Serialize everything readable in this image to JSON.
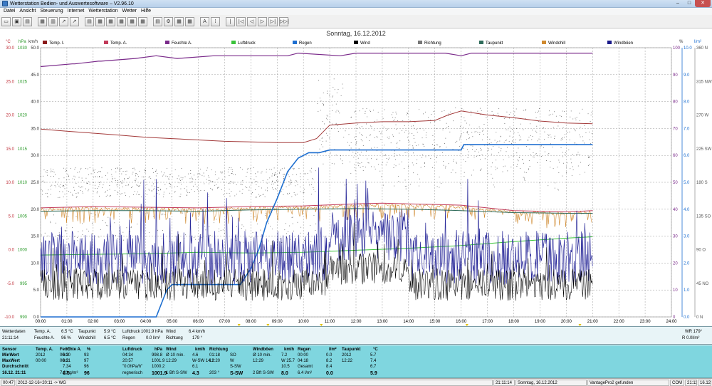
{
  "window": {
    "title": "Wetterstation Bedien- und Auswertesoftware – V2.96.10"
  },
  "menu": [
    "Datei",
    "Ansicht",
    "Steuerung",
    "Internet",
    "Wetterstation",
    "Wetter",
    "Hilfe"
  ],
  "toolbar": {
    "icons": [
      "open-icon",
      "save-icon",
      "print-icon",
      "table-icon",
      "chart-icon",
      "chart2-icon",
      "chart3-icon",
      "list-icon",
      "grid-icon",
      "grid2-icon",
      "grid3-icon",
      "grid4-icon",
      "grid5-icon",
      "export-icon",
      "settings-icon",
      "calc-icon",
      "calendar-icon",
      "font-a-icon",
      "text-icon",
      "nav-first-icon",
      "nav-prev-icon",
      "nav-back-icon",
      "nav-forward-icon",
      "nav-next-icon",
      "nav-last-icon"
    ],
    "glyphs": [
      "▭",
      "▣",
      "▤",
      "▦",
      "▥",
      "↗",
      "↗",
      "▤",
      "▦",
      "▦",
      "▦",
      "▦",
      "▦",
      "▤",
      "⚙",
      "▦",
      "▦",
      "A",
      "⁞",
      "|",
      "|◁",
      "◁",
      "▷",
      "▷|",
      "▷▷|"
    ]
  },
  "chart_data": {
    "type": "line",
    "title": "Sonntag, 16.12.2012",
    "x_ticks": [
      "00:00",
      "01:00",
      "02:00",
      "03:00",
      "04:00",
      "05:00",
      "06:00",
      "07:00",
      "08:00",
      "09:00",
      "10:00",
      "11:00",
      "12:00",
      "13:00",
      "14:00",
      "15:00",
      "16:00",
      "17:00",
      "18:00",
      "19:00",
      "20:00",
      "21:00",
      "22:00",
      "23:00",
      "24:00"
    ],
    "x_range_hours": [
      0,
      24
    ],
    "x_markers": [
      {
        "label": "07:33",
        "hour": 7.55
      },
      {
        "label": "08:39",
        "hour": 8.65
      },
      {
        "label": "10:41",
        "hour": 10.68
      },
      {
        "label": "16:13",
        "hour": 16.22
      },
      {
        "label": "20:31",
        "hour": 20.52
      }
    ],
    "axes": {
      "temp_c": {
        "unit": "°C",
        "range": [
          -10,
          30
        ],
        "ticks": [
          "30.0",
          "25.0",
          "20.0",
          "15.0",
          "10.0",
          "5.0",
          "0.0",
          "-5.0",
          "-10.0"
        ]
      },
      "pressure_hpa": {
        "unit": "hPa",
        "range": [
          990,
          1030
        ],
        "ticks": [
          "1030",
          "1025",
          "1020",
          "1015",
          "1010",
          "1005",
          "1000",
          "995",
          "990"
        ]
      },
      "wind_kmh": {
        "unit": "km/h",
        "range": [
          0,
          50
        ],
        "ticks": [
          "50.0",
          "45.0",
          "40.0",
          "35.0",
          "30.0",
          "25.0",
          "20.0",
          "15.0",
          "10.0",
          "5.0",
          "0.0"
        ]
      },
      "humidity_pct": {
        "unit": "%",
        "range": [
          0,
          100
        ],
        "ticks": [
          "100",
          "90",
          "80",
          "70",
          "60",
          "50",
          "40",
          "30",
          "20",
          "10",
          "0"
        ]
      },
      "rain_lm2": {
        "unit": "l/m²",
        "range": [
          0,
          10
        ],
        "ticks": [
          "10.0",
          "9.0",
          "8.0",
          "7.0",
          "6.0",
          "5.0",
          "4.0",
          "3.0",
          "2.0",
          "1.0",
          "0.0"
        ]
      },
      "direction": {
        "ticks": [
          "360 N",
          "315 NW",
          "270 W",
          "225 SW",
          "180 S",
          "135 SO",
          "90 O",
          "45 NO",
          "0 N"
        ]
      }
    },
    "legend": [
      {
        "name": "Temp. I.",
        "color": "#8b1a1a"
      },
      {
        "name": "Temp. A.",
        "color": "#c23b5a"
      },
      {
        "name": "Feuchte A.",
        "color": "#7a2a8a"
      },
      {
        "name": "Luftdruck",
        "color": "#3ac23a"
      },
      {
        "name": "Regen",
        "color": "#1e6fd0"
      },
      {
        "name": "Wind",
        "color": "#000000"
      },
      {
        "name": "Richtung",
        "color": "#777777"
      },
      {
        "name": "Taupunkt",
        "color": "#2f6b5a"
      },
      {
        "name": "Windchill",
        "color": "#d08a30"
      },
      {
        "name": "Windböen",
        "color": "#1a1a8a"
      }
    ],
    "series": {
      "temp_inside": {
        "axis": "temp_c",
        "hours": [
          0,
          1,
          2,
          3,
          4,
          5,
          6,
          7,
          8,
          9,
          10,
          10.5,
          11,
          12,
          13,
          14,
          15,
          15.5,
          16,
          17,
          18,
          19,
          20,
          21
        ],
        "values": [
          17.9,
          17.6,
          17.3,
          17.0,
          16.7,
          16.5,
          16.3,
          16.1,
          16.0,
          15.9,
          15.9,
          16.5,
          18.5,
          18.8,
          19.0,
          19.0,
          19.2,
          20.0,
          20.6,
          20.0,
          19.6,
          19.1,
          18.8,
          18.7
        ]
      },
      "humidity": {
        "axis": "humidity_pct",
        "hours": [
          0,
          1.2,
          1.3,
          2.2,
          2.3,
          3.6,
          4.4,
          5.2,
          6.6,
          7.0,
          7.4,
          8.6,
          9.4,
          9.8,
          11.4,
          12.0,
          13.0,
          15.4,
          16.0,
          16.4,
          18.2,
          21.0
        ],
        "values": [
          93,
          94,
          94,
          95,
          95,
          96,
          97,
          96,
          97,
          97,
          97,
          97,
          97,
          98,
          97,
          98,
          98,
          98,
          97,
          98,
          98,
          98
        ]
      },
      "temp_outside": {
        "axis": "temp_c",
        "hours": [
          0,
          2,
          4,
          6,
          8,
          10,
          12,
          13,
          14,
          16,
          18,
          20,
          21
        ],
        "values": [
          6.2,
          6.4,
          6.3,
          6.2,
          6.4,
          6.5,
          6.8,
          6.9,
          6.8,
          6.6,
          5.8,
          5.6,
          5.8
        ]
      },
      "dewpoint": {
        "axis": "temp_c",
        "hours": [
          0,
          2,
          4,
          6,
          8,
          10,
          12,
          14,
          16,
          18,
          20,
          21
        ],
        "values": [
          5.7,
          5.8,
          5.8,
          5.7,
          5.9,
          6.0,
          6.1,
          6.0,
          5.8,
          5.5,
          5.4,
          5.4
        ]
      },
      "pressure": {
        "axis": "pressure_hpa",
        "hours": [
          0,
          2,
          4,
          6,
          8,
          10,
          12,
          14,
          16,
          18,
          20,
          21
        ],
        "values": [
          999.2,
          999.3,
          999.4,
          999.6,
          999.5,
          999.6,
          999.9,
          1000.2,
          1000.6,
          1001.2,
          1001.7,
          1001.9
        ]
      },
      "rain": {
        "axis": "rain_lm2",
        "hours": [
          0,
          4.4,
          4.8,
          5.0,
          7.6,
          8.0,
          8.3,
          8.6,
          9.0,
          9.4,
          9.8,
          10.2,
          10.6,
          11.0,
          12.0,
          14.0,
          16.0,
          16.1,
          17.0,
          21.0
        ],
        "values": [
          0,
          0,
          1.0,
          1.2,
          1.2,
          1.8,
          2.5,
          3.5,
          4.4,
          5.4,
          5.9,
          6.1,
          6.1,
          6.2,
          6.2,
          6.2,
          6.2,
          6.4,
          6.4,
          6.4
        ]
      }
    },
    "grid": true
  },
  "mid": {
    "left_title": "Wetterdaten",
    "left_time": "21:11:14",
    "temp_a_label": "Temp. A.",
    "temp_a_value": "6.5 °C",
    "feuchte_label": "Feuchte A.",
    "feuchte_value": "96 %",
    "taupunkt_label": "Taupunkt",
    "taupunkt_value": "5.9 °C",
    "windchill_label": "Windchill",
    "windchill_value": "6.5 °C",
    "luftdruck_label": "Luftdruck",
    "luftdruck_value": "1001.9 hPa",
    "regen_label": "Regen",
    "regen_value": "0.0 l/m²",
    "wind_label": "Wind",
    "wind_value": "6.4 km/h",
    "richtung_label": "Richtung",
    "richtung_value": "179 °",
    "wr_text": "WR 179°",
    "r_text": "R 0.0l/m²"
  },
  "summary": {
    "rowlabels": [
      "Sensor",
      "MinWert",
      "MaxWert",
      "Durchschnitt",
      "16.12. 21:11"
    ],
    "temp_a": {
      "head": "Temp. A.",
      "unit": "°C",
      "rows": [
        [
          "2012",
          "6.3"
        ],
        [
          "00:00",
          "8.2"
        ],
        [
          "",
          "7.34"
        ],
        [
          "",
          "6.5"
        ]
      ]
    },
    "feuchte": {
      "head": "Feuchte A.",
      "unit": "%",
      "rows": [
        [
          "00:00",
          "93"
        ],
        [
          "06:01",
          "97"
        ],
        [
          "",
          "96"
        ],
        [
          "7.21 g/m³",
          "96"
        ]
      ]
    },
    "luftdruck": {
      "head": "Luftdruck",
      "unit": "hPa",
      "rows": [
        [
          "04:34",
          "998.8"
        ],
        [
          "20:57",
          "1001.9"
        ],
        [
          "\"0.0hPa/h\"",
          "1000.2"
        ],
        [
          "regnerisch",
          "1001.9"
        ]
      ]
    },
    "wind": {
      "head": "Wind",
      "unit": "km/h",
      "rows": [
        [
          "Ø 10 min.",
          "4.6"
        ],
        [
          "12:29",
          "W-SW 14.1"
        ],
        [
          "",
          "6.1"
        ],
        [
          "1 Bft S-SW",
          "4.3"
        ]
      ]
    },
    "richtung": {
      "head": "Richtung",
      "rows": [
        [
          "01:18",
          "SO"
        ],
        [
          "12:20",
          "W"
        ],
        [
          "",
          "S-SW"
        ],
        [
          "203 °",
          "S-SW"
        ]
      ]
    },
    "windboen": {
      "head": "Windböen",
      "unit": "km/h",
      "rows": [
        [
          "Ø 10 min.",
          "7.2"
        ],
        [
          "12:29",
          "W 25.7"
        ],
        [
          "",
          "10.5"
        ],
        [
          "2 Bft S-SW",
          "8.0"
        ]
      ]
    },
    "regen": {
      "head": "Regen",
      "unit": "l/m²",
      "rows": [
        [
          "00:00",
          "0.0"
        ],
        [
          "04:18",
          "8.2"
        ],
        [
          "Gesamt",
          "8.4"
        ],
        [
          "6.4 l/m²",
          "0.0"
        ]
      ]
    },
    "taupunkt": {
      "head": "Taupunkt",
      "unit": "°C",
      "rows": [
        [
          "2012",
          "5.7"
        ],
        [
          "12:22",
          "7.4"
        ],
        [
          "",
          "6.7"
        ],
        [
          "",
          "5.9"
        ]
      ]
    }
  },
  "status": {
    "s1": "00:47",
    "s2": "2012-12-16+20:11 -> WG",
    "s3": "21:11:14",
    "s4": "Sonntag, 16.12.2012",
    "s5": "VantagePro2 gefunden",
    "s6": "COM 3",
    "s7": "21:11",
    "s8": "16.12.2012"
  }
}
